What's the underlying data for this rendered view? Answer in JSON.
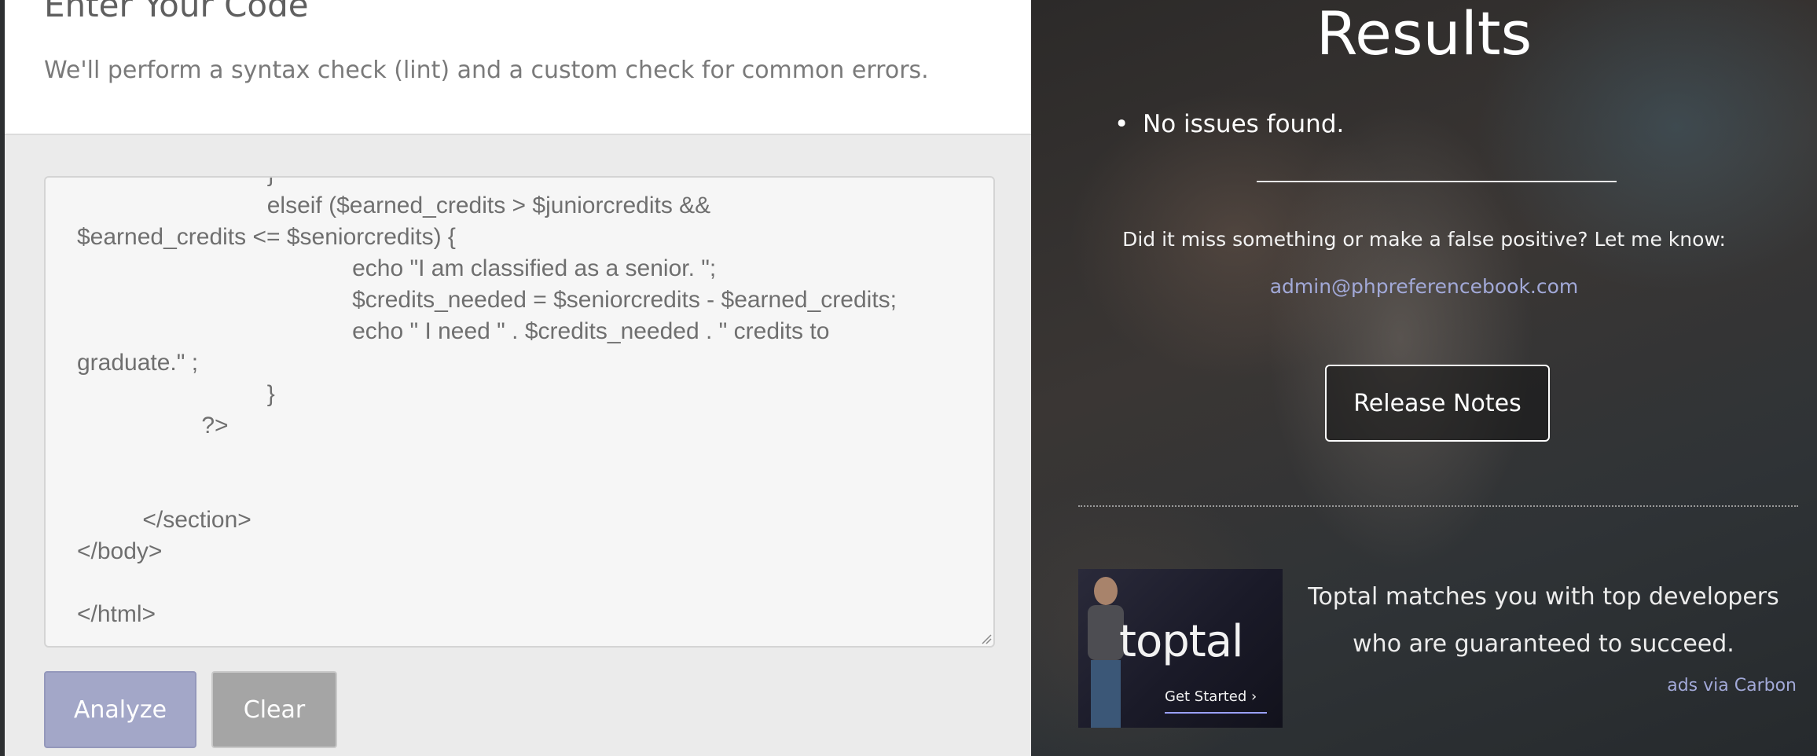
{
  "left": {
    "title": "Enter Your Code",
    "subtitle": "We'll perform a syntax check (lint) and a custom check for common errors.",
    "code_lines": [
      "                             }",
      "                             elseif ($earned_credits > $juniorcredits &&",
      "$earned_credits <= $seniorcredits) {",
      "                                          echo \"I am classified as a senior. \";",
      "                                          $credits_needed = $seniorcredits - $earned_credits;",
      "                                          echo \" I need \" . $credits_needed . \" credits to",
      "graduate.\" ;",
      "                             }",
      "                   ?>",
      "",
      "",
      "          </section>",
      "</body>",
      "",
      "</html>"
    ],
    "buttons": {
      "analyze": "Analyze",
      "clear": "Clear"
    }
  },
  "right": {
    "title": "Results",
    "results": [
      "No issues found."
    ],
    "feedback_text": "Did it miss something or make a false positive? Let me know:",
    "contact_email": "admin@phpreferencebook.com",
    "release_notes_label": "Release Notes",
    "ad": {
      "logo_text": "toptal",
      "cta_text": "Get Started ›",
      "text": "Toptal matches you with top developers who are guaranteed to succeed.",
      "via_label": "ads via Carbon"
    }
  }
}
